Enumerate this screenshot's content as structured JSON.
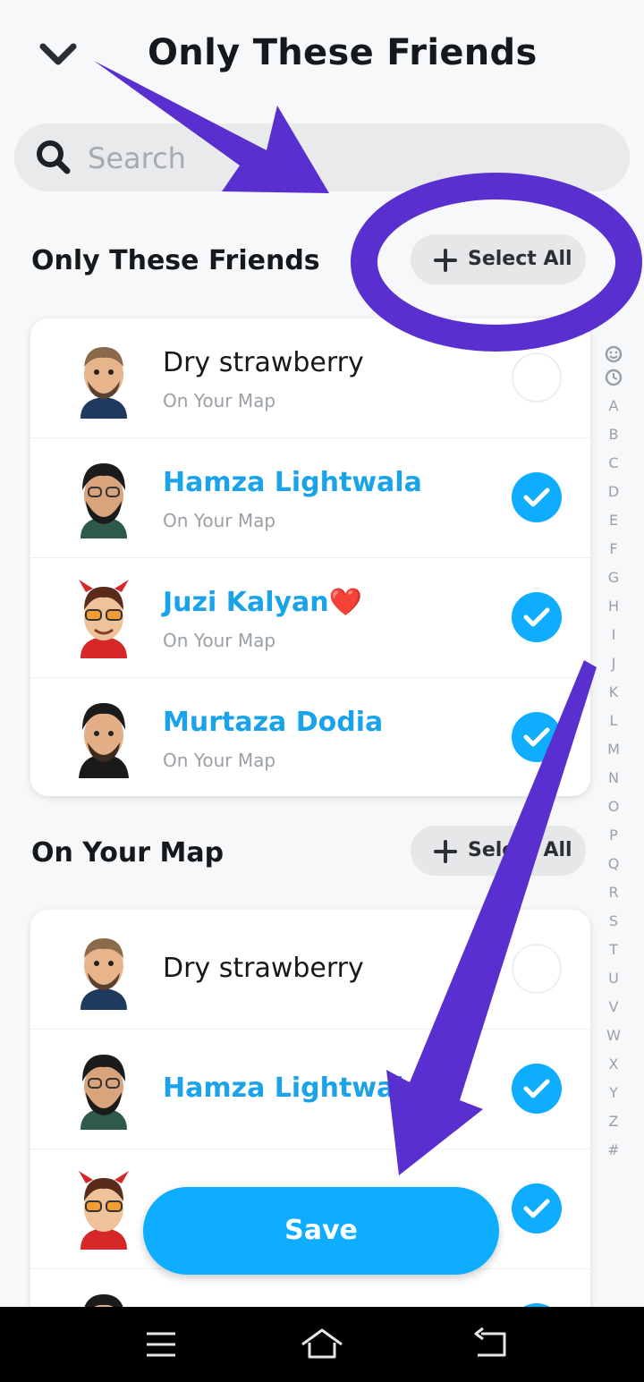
{
  "header": {
    "title": "Only These Friends"
  },
  "search": {
    "placeholder": "Search"
  },
  "section1": {
    "title": "Only These Friends",
    "select_all": "Select All",
    "friends": [
      {
        "name": "Dry strawberry",
        "sub": "On Your Map",
        "selected": false
      },
      {
        "name": "Hamza Lightwala",
        "sub": "On Your Map",
        "selected": true
      },
      {
        "name": "Juzi Kalyan❤️",
        "sub": "On Your Map",
        "selected": true
      },
      {
        "name": "Murtaza Dodia",
        "sub": "On Your Map",
        "selected": true
      }
    ]
  },
  "section2": {
    "title": "On Your Map",
    "select_all": "Select All",
    "friends": [
      {
        "name": "Dry strawberry",
        "selected": false
      },
      {
        "name": "Hamza Lightwala",
        "selected": true
      },
      {
        "name": "",
        "selected": true
      },
      {
        "name": "",
        "selected": true
      }
    ]
  },
  "alphabet": [
    "A",
    "B",
    "C",
    "D",
    "E",
    "F",
    "G",
    "H",
    "I",
    "J",
    "K",
    "L",
    "M",
    "N",
    "O",
    "P",
    "Q",
    "R",
    "S",
    "T",
    "U",
    "V",
    "W",
    "X",
    "Y",
    "Z",
    "#"
  ],
  "save_label": "Save",
  "colors": {
    "accent": "#0eadff",
    "selected_name": "#1aa3e8",
    "annotation": "#5a2fd0"
  },
  "icons": {
    "header": "chevron-down-icon",
    "search": "search-icon",
    "add": "plus-icon",
    "nav": [
      "menu-icon",
      "home-icon",
      "back-icon"
    ]
  }
}
